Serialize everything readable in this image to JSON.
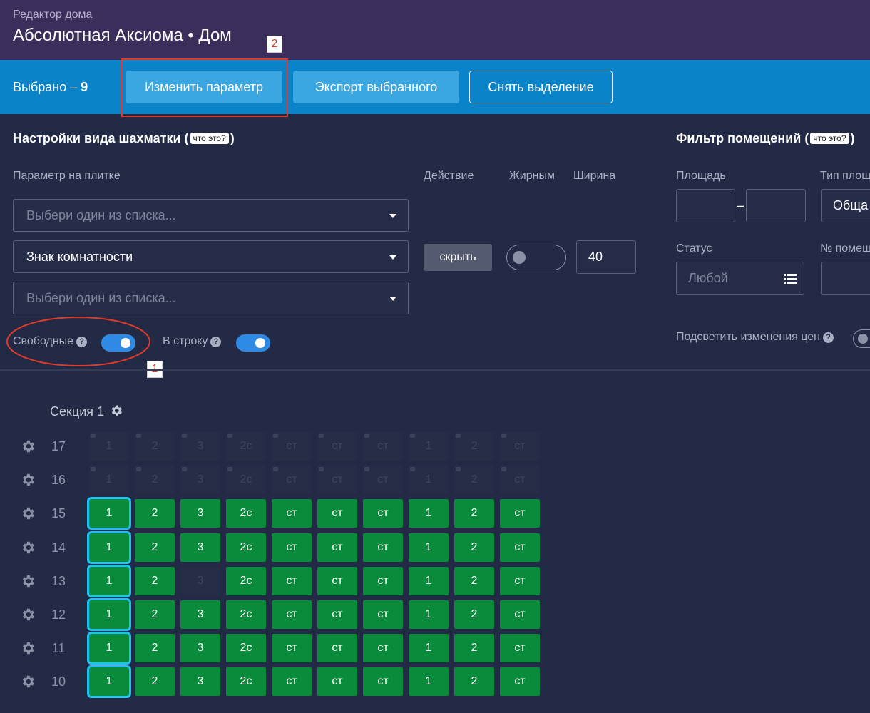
{
  "header": {
    "subtitle": "Редактор дома",
    "title": "Абсолютная Аксиома • Дом"
  },
  "toolbar": {
    "selected_label": "Выбрано – ",
    "selected_count": "9",
    "buttons": [
      "Изменить параметр",
      "Экспорт выбранного",
      "Снять выделение"
    ]
  },
  "callouts": [
    "1",
    "2"
  ],
  "view_settings": {
    "title": "Настройки вида шахматки",
    "hint": "что это?",
    "param_label": "Параметр на плитке",
    "action_label": "Действие",
    "bold_label": "Жирным",
    "width_label": "Ширина",
    "selects": [
      {
        "placeholder": "Выбери один из списка...",
        "value": ""
      },
      {
        "placeholder": "",
        "value": "Знак комнатности"
      },
      {
        "placeholder": "Выбери один из списка...",
        "value": ""
      }
    ],
    "action_button": "скрыть",
    "bold_on": false,
    "width_value": "40",
    "free_label": "Свободные",
    "free_on": true,
    "inline_label": "В строку",
    "inline_on": true
  },
  "room_filter": {
    "title": "Фильтр помещений",
    "hint": "что это?",
    "area_label": "Площадь",
    "area_dash": "–",
    "type_label": "Тип площ",
    "type_value": "Обща",
    "status_label": "Статус",
    "status_placeholder": "Любой",
    "room_no_label": "№ помещ",
    "highlight_label": "Подсветить изменения цен",
    "highlight_on": false
  },
  "section": {
    "label": "Секция 1"
  },
  "grid": {
    "columns": [
      "1",
      "2",
      "3",
      "2с",
      "ст",
      "ст",
      "ст",
      "1",
      "2",
      "ст"
    ],
    "rows": [
      {
        "floor": "17",
        "state": "dim"
      },
      {
        "floor": "16",
        "state": "dim"
      },
      {
        "floor": "15",
        "state": "green"
      },
      {
        "floor": "14",
        "state": "green"
      },
      {
        "floor": "13",
        "state": "green",
        "dim_cells": [
          2
        ]
      },
      {
        "floor": "12",
        "state": "green"
      },
      {
        "floor": "11",
        "state": "green"
      },
      {
        "floor": "10",
        "state": "green"
      }
    ],
    "selected_column": 0
  },
  "colors": {
    "header": "#3b2e5a",
    "toolbar": "#0a83c9",
    "cell_green": "#0a8a3b",
    "selection": "#1ec2f0",
    "callout": "#e23a2a"
  }
}
